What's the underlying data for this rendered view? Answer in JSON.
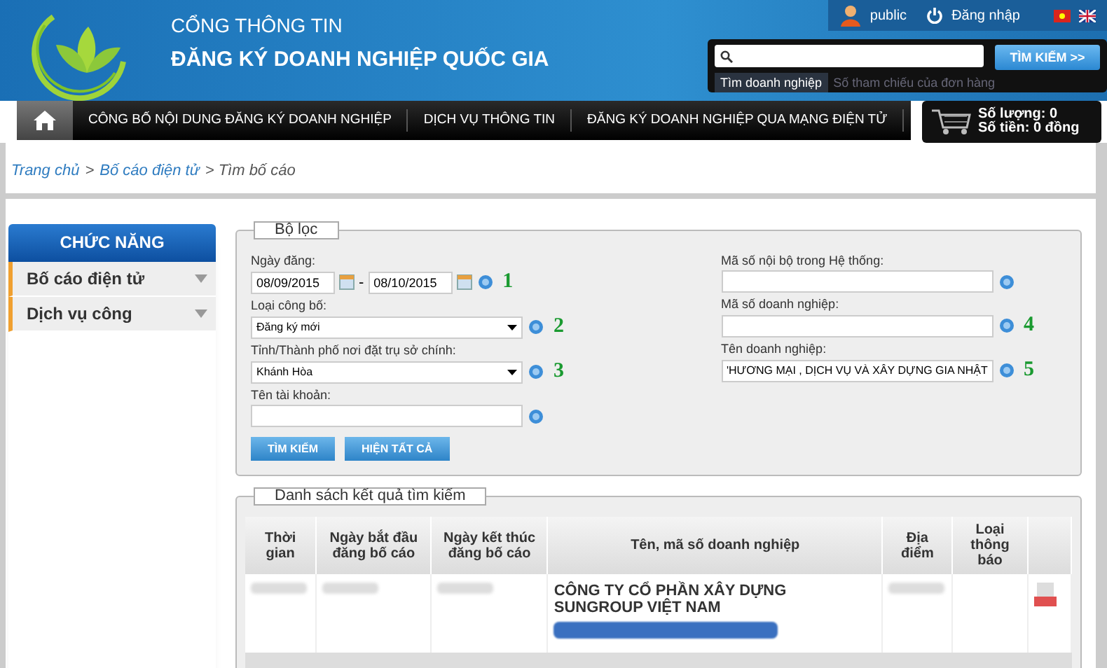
{
  "header": {
    "portal_label": "CỔNG THÔNG TIN",
    "portal_title": "ĐĂNG KÝ DOANH NGHIỆP QUỐC GIA",
    "user": "public",
    "login": "Đăng nhập",
    "search": {
      "button": "TÌM KIẾM >>",
      "tabs": [
        {
          "label": "Tìm doanh nghiệp",
          "selected": true
        },
        {
          "label": "Số tham chiếu của đơn hàng",
          "selected": false
        }
      ]
    }
  },
  "nav": {
    "items": [
      "CÔNG BỐ NỘI DUNG ĐĂNG KÝ DOANH NGHIỆP",
      "DỊCH VỤ THÔNG TIN",
      "ĐĂNG KÝ DOANH NGHIỆP QUA MẠNG ĐIỆN TỬ"
    ],
    "cart": {
      "quantity": "Số lượng: 0",
      "amount": "Số tiền: 0 đồng"
    }
  },
  "breadcrumb": [
    {
      "label": "Trang chủ",
      "link": true
    },
    {
      "label": ">",
      "link": false
    },
    {
      "label": "Bố cáo điện tử",
      "link": true
    },
    {
      "label": "> Tìm bố cáo",
      "link": false
    }
  ],
  "sidebar": {
    "title": "CHỨC NĂNG",
    "items": [
      "Bố cáo điện tử",
      "Dịch vụ công"
    ]
  },
  "filter": {
    "legend": "Bộ lọc",
    "left": [
      {
        "kind": "date_range",
        "label": "Ngày đăng:",
        "from": "08/09/2015",
        "separator": "-",
        "to": "08/10/2015",
        "marker": "1"
      },
      {
        "kind": "select",
        "label": "Loại công bố:",
        "value": "Đăng ký mới",
        "marker": "2"
      },
      {
        "kind": "select",
        "label": "Tỉnh/Thành phố nơi đặt trụ sở chính:",
        "value": "Khánh Hòa",
        "marker": "3"
      },
      {
        "kind": "text",
        "label": "Tên tài khoản:"
      }
    ],
    "right": [
      {
        "kind": "text",
        "label": "Mã số nội bộ trong Hệ thống:"
      },
      {
        "kind": "text",
        "label": "Mã số doanh nghiệp:",
        "marker": "4"
      },
      {
        "kind": "text",
        "label": "Tên doanh nghiệp:",
        "value": "'HƯƠNG MẠI , DỊCH VỤ VÀ XÂY DỰNG GIA NHẬT",
        "marker": "5"
      }
    ],
    "buttons": [
      "TÌM KIẾM",
      "HIỆN TẤT CẢ"
    ]
  },
  "results": {
    "legend": "Danh sách kết quả tìm kiếm",
    "columns": [
      "Thời gian",
      "Ngày bắt đầu đăng bố cáo",
      "Ngày kết thúc đăng bố cáo",
      "Tên, mã số doanh nghiệp",
      "Địa điểm",
      "Loại thông báo"
    ],
    "rows": [
      {
        "name": "CÔNG TY CỔ PHẦN XÂY DỰNG SUNGROUP VIỆT NAM"
      }
    ]
  }
}
